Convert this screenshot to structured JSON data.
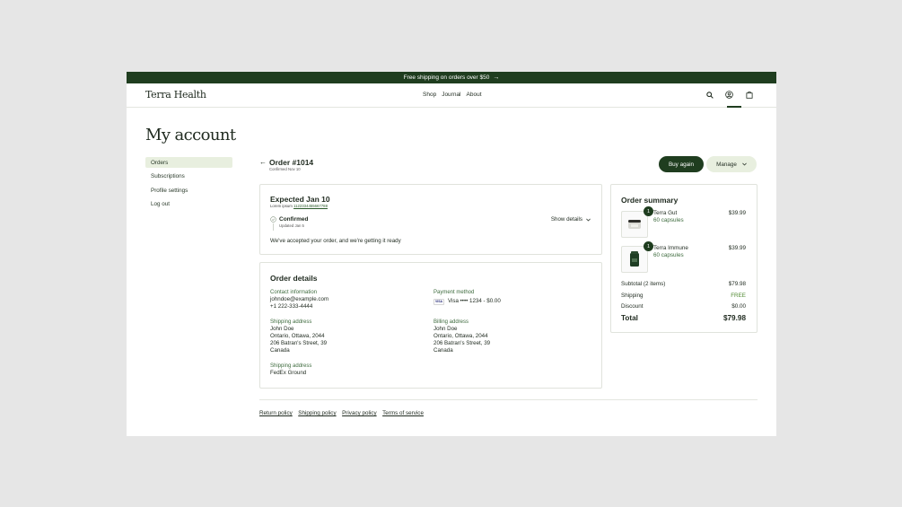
{
  "promo": {
    "text": "Free shipping on orders over $50",
    "arrow_icon": "arrow-right-icon"
  },
  "brand": {
    "logo": "Terra Health",
    "accent": "#1f3d1f"
  },
  "nav": {
    "items": [
      "Shop",
      "Journal",
      "About"
    ],
    "icons": [
      "search-icon",
      "account-icon",
      "bag-icon"
    ]
  },
  "page": {
    "title": "My account"
  },
  "sidebar": {
    "items": [
      {
        "label": "Orders",
        "active": true
      },
      {
        "label": "Subscriptions"
      },
      {
        "label": "Profile settings"
      },
      {
        "label": "Log out"
      }
    ]
  },
  "order": {
    "title": "Order #1014",
    "subtitle": "Confirmed Nov 10",
    "buy_again": "Buy again",
    "manage": "Manage"
  },
  "status": {
    "expected": "Expected Jan 10",
    "tracking_label": "Lorem ipsum",
    "tracking_number": "1122334455667788",
    "step": "Confirmed",
    "step_date": "Updated Jan 5",
    "show_details": "Show details",
    "message": "We've accepted your order, and we're getting it ready"
  },
  "details": {
    "title": "Order details",
    "contact": {
      "label": "Contact information",
      "email": "johndoe@example.com",
      "phone": "+1 222-333-4444"
    },
    "payment": {
      "label": "Payment method",
      "brand": "VISA",
      "text": "Visa •••• 1234 - $0.00"
    },
    "shipping_address": {
      "label": "Shipping address",
      "lines": [
        "John Doe",
        "Ontario, Ottawa, 2044",
        "206 Batran's Street, 39",
        "Canada"
      ]
    },
    "billing_address": {
      "label": "Billing address",
      "lines": [
        "John Doe",
        "Ontario, Ottawa, 2044",
        "206 Batran's Street, 39",
        "Canada"
      ]
    },
    "shipping_method": {
      "label": "Shipping address",
      "value": "FedEx Ground"
    }
  },
  "summary": {
    "title": "Order summary",
    "items": [
      {
        "name": "Terra Gut",
        "variant": "60 capsules",
        "price": "$39.99",
        "qty": "1"
      },
      {
        "name": "Terra Immune",
        "variant": "60 capsules",
        "price": "$39.99",
        "qty": "1"
      }
    ],
    "subtotal_label": "Subtotal (2 items)",
    "subtotal": "$79.98",
    "shipping_label": "Shipping",
    "shipping": "FREE",
    "discount_label": "Discount",
    "discount": "$0.00",
    "total_label": "Total",
    "total": "$79.98"
  },
  "footer": {
    "links": [
      "Return policy",
      "Shipping policy",
      "Privacy policy",
      "Terms of service"
    ]
  }
}
